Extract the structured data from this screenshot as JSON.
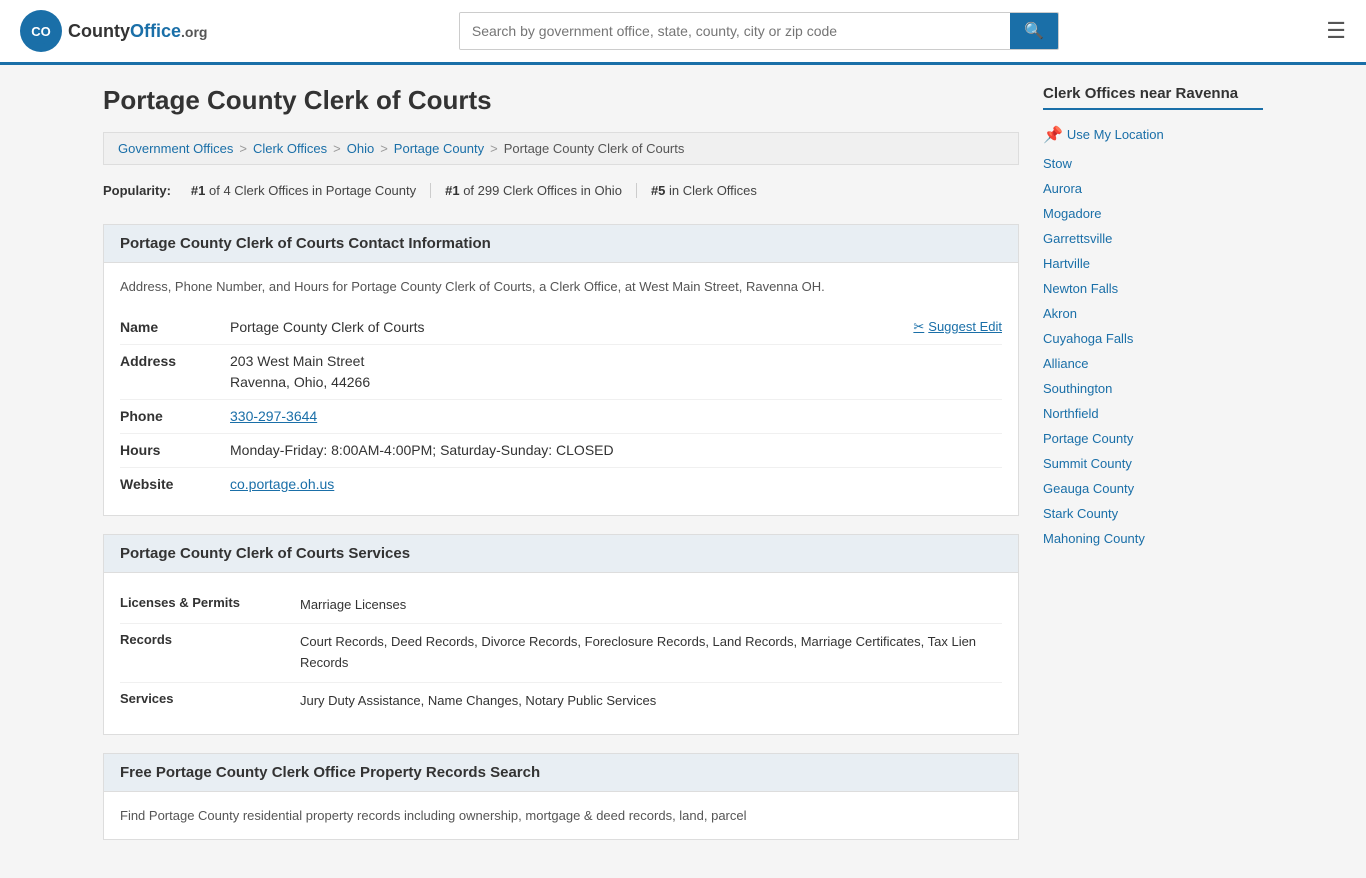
{
  "header": {
    "logo_text": "CountyOffice",
    "logo_suffix": ".org",
    "search_placeholder": "Search by government office, state, county, city or zip code"
  },
  "page": {
    "title": "Portage County Clerk of Courts"
  },
  "breadcrumb": {
    "items": [
      {
        "label": "Government Offices",
        "url": "#"
      },
      {
        "label": "Clerk Offices",
        "url": "#"
      },
      {
        "label": "Ohio",
        "url": "#"
      },
      {
        "label": "Portage County",
        "url": "#"
      },
      {
        "label": "Portage County Clerk of Courts",
        "url": "#"
      }
    ]
  },
  "popularity": {
    "label": "Popularity:",
    "items": [
      {
        "text": "#1 of 4 Clerk Offices in Portage County"
      },
      {
        "text": "#1 of 299 Clerk Offices in Ohio"
      },
      {
        "text": "#5 in Clerk Offices"
      }
    ]
  },
  "contact_section": {
    "title": "Portage County Clerk of Courts Contact Information",
    "description": "Address, Phone Number, and Hours for Portage County Clerk of Courts, a Clerk Office, at West Main Street, Ravenna OH.",
    "name_label": "Name",
    "name_value": "Portage County Clerk of Courts",
    "suggest_edit": "Suggest Edit",
    "address_label": "Address",
    "address_line1": "203 West Main Street",
    "address_line2": "Ravenna, Ohio, 44266",
    "phone_label": "Phone",
    "phone_value": "330-297-3644",
    "hours_label": "Hours",
    "hours_value": "Monday-Friday: 8:00AM-4:00PM; Saturday-Sunday: CLOSED",
    "website_label": "Website",
    "website_value": "co.portage.oh.us"
  },
  "services_section": {
    "title": "Portage County Clerk of Courts Services",
    "rows": [
      {
        "label": "Licenses & Permits",
        "value": "Marriage Licenses"
      },
      {
        "label": "Records",
        "value": "Court Records, Deed Records, Divorce Records, Foreclosure Records, Land Records, Marriage Certificates, Tax Lien Records"
      },
      {
        "label": "Services",
        "value": "Jury Duty Assistance, Name Changes, Notary Public Services"
      }
    ]
  },
  "property_section": {
    "title": "Free Portage County Clerk Office Property Records Search",
    "description": "Find Portage County residential property records including ownership, mortgage & deed records, land, parcel"
  },
  "sidebar": {
    "title": "Clerk Offices near Ravenna",
    "use_location": "Use My Location",
    "links": [
      "Stow",
      "Aurora",
      "Mogadore",
      "Garrettsville",
      "Hartville",
      "Newton Falls",
      "Akron",
      "Cuyahoga Falls",
      "Alliance",
      "Southington",
      "Northfield",
      "Portage County",
      "Summit County",
      "Geauga County",
      "Stark County",
      "Mahoning County"
    ]
  }
}
